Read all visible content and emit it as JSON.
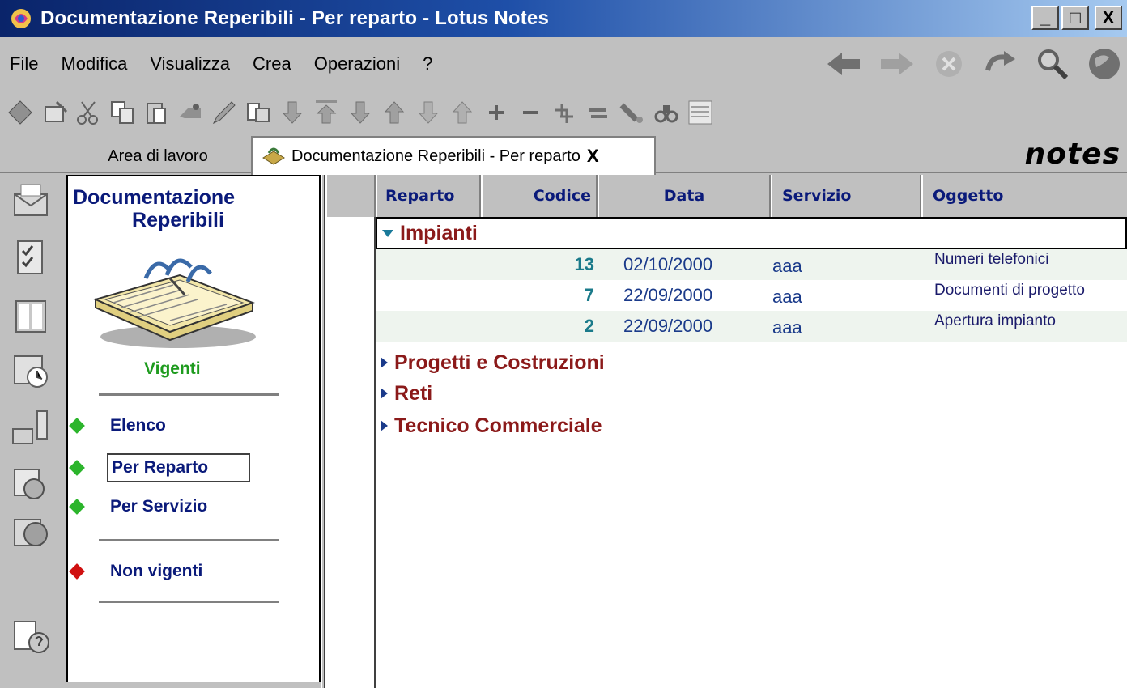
{
  "window": {
    "title": "Documentazione Reperibili - Per reparto - Lotus Notes",
    "controls": [
      "_",
      "□",
      "X"
    ]
  },
  "menu": {
    "items": [
      "File",
      "Modifica",
      "Visualizza",
      "Crea",
      "Operazioni",
      "?"
    ]
  },
  "tabs": {
    "workspace": "Area di lavoro",
    "active": "Documentazione Reperibili - Per reparto",
    "close": "X",
    "brand": "notes"
  },
  "navigator": {
    "title_line1": "Documentazione",
    "title_line2": "Reperibili",
    "group_label": "Vigenti",
    "items": [
      {
        "label": "Elenco",
        "status": "green"
      },
      {
        "label": "Per Reparto",
        "status": "green",
        "selected": true
      },
      {
        "label": "Per Servizio",
        "status": "green"
      }
    ],
    "other": {
      "label": "Non vigenti",
      "status": "red"
    }
  },
  "view": {
    "columns": [
      "Reparto",
      "Codice",
      "Data",
      "Servizio",
      "Oggetto"
    ],
    "categories": [
      {
        "name": "Impianti",
        "expanded": true,
        "rows": [
          {
            "codice": "13",
            "data": "02/10/2000",
            "servizio": "aaa",
            "oggetto": "Numeri telefonici"
          },
          {
            "codice": "7",
            "data": "22/09/2000",
            "servizio": "aaa",
            "oggetto": "Documenti di progetto"
          },
          {
            "codice": "2",
            "data": "22/09/2000",
            "servizio": "aaa",
            "oggetto": "Apertura impianto"
          }
        ]
      },
      {
        "name": "Progetti e Costruzioni",
        "expanded": false
      },
      {
        "name": "Reti",
        "expanded": false
      },
      {
        "name": "Tecnico Commerciale",
        "expanded": false
      }
    ]
  },
  "colors": {
    "titlebar": "#0a246a",
    "category_text": "#8b1a1a",
    "nav_text": "#0a1a7a",
    "vigenti": "#1e9b1e"
  },
  "icons": {
    "toolbar": [
      "open-db-icon",
      "edit-doc-icon",
      "cut-icon",
      "copy-icon",
      "paste-icon",
      "properties-icon",
      "edit-pencil-icon",
      "link-icon",
      "next-unread-icon",
      "previous-unread-icon",
      "next-icon",
      "previous-icon",
      "next-main-icon",
      "expand-icon",
      "collapse-icon",
      "expand-all-icon",
      "collapse-all-icon",
      "search-icon",
      "find-icon",
      "view-icon"
    ],
    "nav": [
      "back-arrow-icon",
      "forward-arrow-icon",
      "stop-icon",
      "refresh-icon",
      "magnifier-icon",
      "globe-icon"
    ],
    "sidebar": [
      "mail-icon",
      "todo-icon",
      "addressbook-icon",
      "calendar-icon",
      "replication-icon",
      "discussion-icon",
      "web-icon",
      "help-icon"
    ]
  }
}
